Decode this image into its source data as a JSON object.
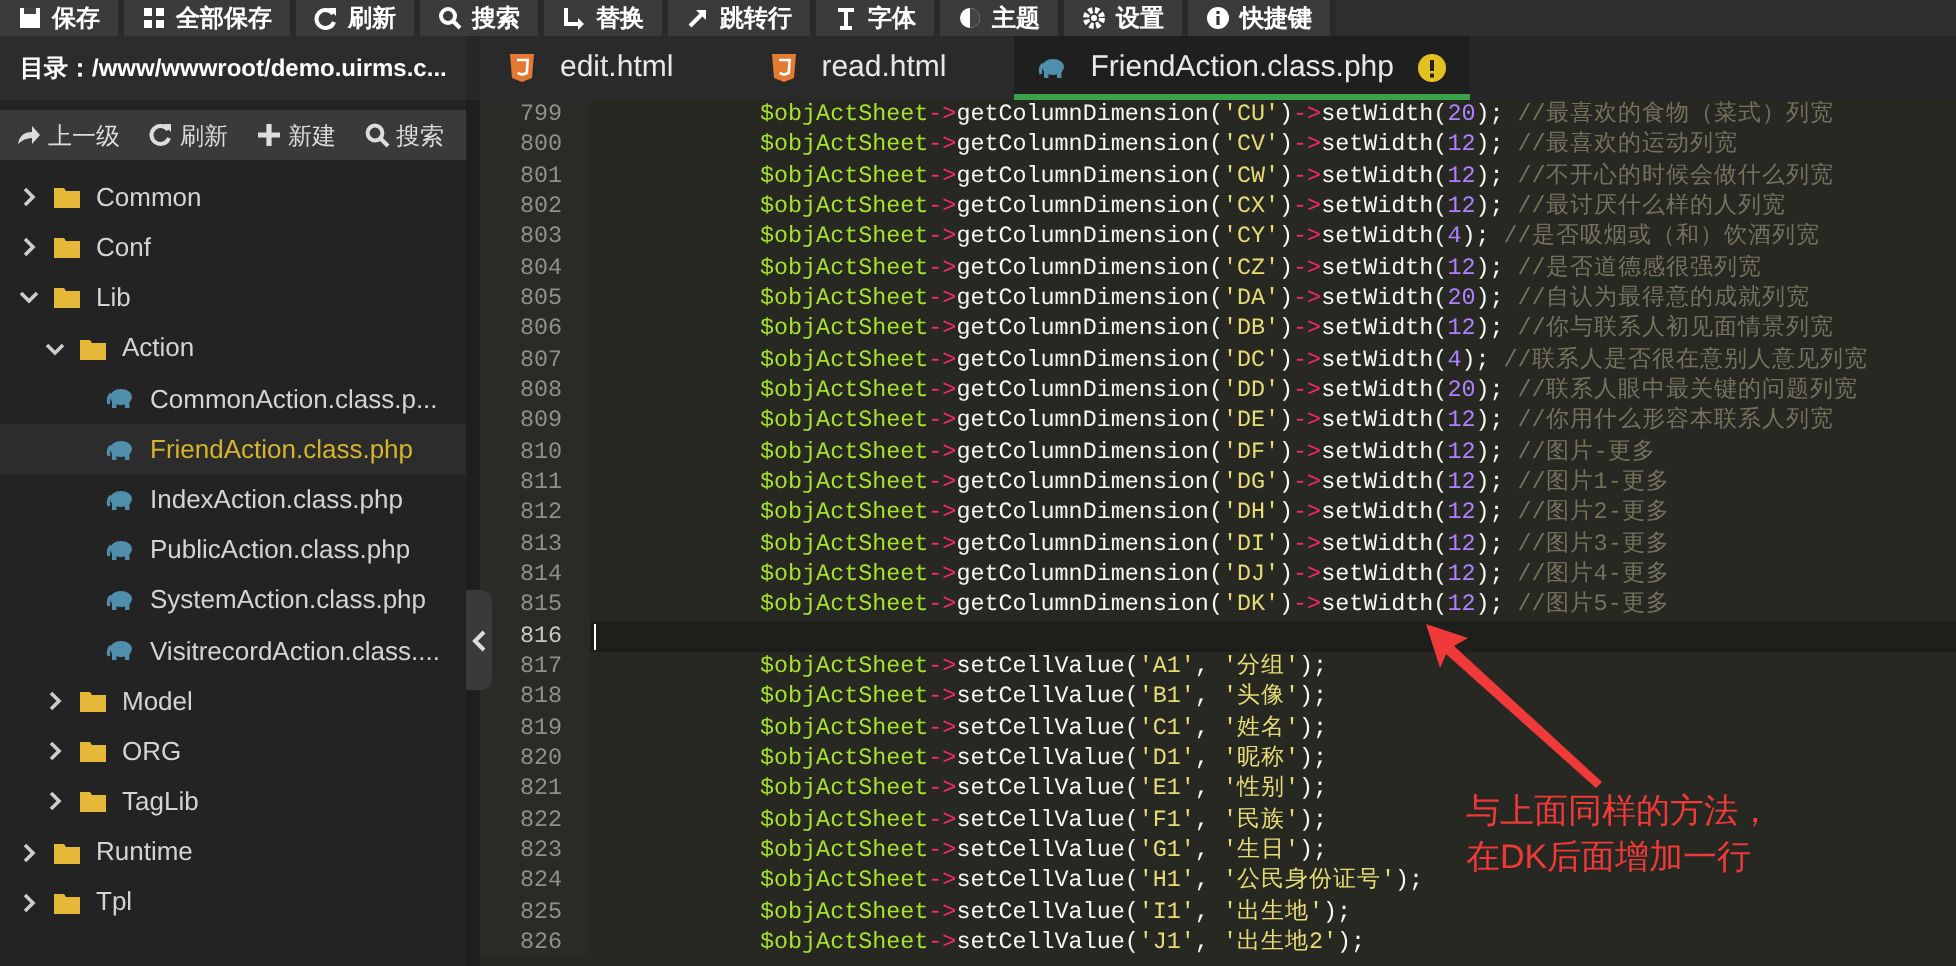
{
  "toolbar": [
    "保存",
    "全部保存",
    "刷新",
    "搜索",
    "替换",
    "跳转行",
    "字体",
    "主题",
    "设置",
    "快捷键"
  ],
  "directory": "目录：/www/wwwroot/demo.uirms.c...",
  "tabs": [
    {
      "label": "edit.html",
      "kind": "html",
      "selected": false,
      "warning": false
    },
    {
      "label": "read.html",
      "kind": "html",
      "selected": false,
      "warning": false
    },
    {
      "label": "FriendAction.class.php",
      "kind": "php",
      "selected": true,
      "warning": true
    }
  ],
  "file_toolbar": [
    "上一级",
    "刷新",
    "新建",
    "搜索"
  ],
  "tree": [
    {
      "label": "Common",
      "kind": "folder",
      "expanded": false,
      "selected": false
    },
    {
      "label": "Conf",
      "kind": "folder",
      "expanded": false,
      "selected": false
    },
    {
      "label": "Lib",
      "kind": "folder",
      "expanded": true,
      "selected": false,
      "children": [
        {
          "label": "Action",
          "kind": "folder",
          "expanded": true,
          "selected": false,
          "children": [
            {
              "label": "CommonAction.class.p...",
              "kind": "php",
              "selected": false
            },
            {
              "label": "FriendAction.class.php",
              "kind": "php",
              "selected": true
            },
            {
              "label": "IndexAction.class.php",
              "kind": "php",
              "selected": false
            },
            {
              "label": "PublicAction.class.php",
              "kind": "php",
              "selected": false
            },
            {
              "label": "SystemAction.class.php",
              "kind": "php",
              "selected": false
            },
            {
              "label": "VisitrecordAction.class....",
              "kind": "php",
              "selected": false
            }
          ]
        },
        {
          "label": "Model",
          "kind": "folder",
          "expanded": false,
          "selected": false
        },
        {
          "label": "ORG",
          "kind": "folder",
          "expanded": false,
          "selected": false
        },
        {
          "label": "TagLib",
          "kind": "folder",
          "expanded": false,
          "selected": false
        }
      ]
    },
    {
      "label": "Runtime",
      "kind": "folder",
      "expanded": false,
      "selected": false
    },
    {
      "label": "Tpl",
      "kind": "folder",
      "expanded": false,
      "selected": false
    }
  ],
  "editor": {
    "lines": [
      {
        "number": "799",
        "code": "$objActSheet->getColumnDimension('CU')->setWidth(20); //最喜欢的食物（菜式）列宽",
        "current": false
      },
      {
        "number": "800",
        "code": "$objActSheet->getColumnDimension('CV')->setWidth(12); //最喜欢的运动列宽",
        "current": false
      },
      {
        "number": "801",
        "code": "$objActSheet->getColumnDimension('CW')->setWidth(12); //不开心的时候会做什么列宽",
        "current": false
      },
      {
        "number": "802",
        "code": "$objActSheet->getColumnDimension('CX')->setWidth(12); //最讨厌什么样的人列宽",
        "current": false
      },
      {
        "number": "803",
        "code": "$objActSheet->getColumnDimension('CY')->setWidth(4); //是否吸烟或（和）饮酒列宽",
        "current": false
      },
      {
        "number": "804",
        "code": "$objActSheet->getColumnDimension('CZ')->setWidth(12); //是否道德感很强列宽",
        "current": false
      },
      {
        "number": "805",
        "code": "$objActSheet->getColumnDimension('DA')->setWidth(20); //自认为最得意的成就列宽",
        "current": false
      },
      {
        "number": "806",
        "code": "$objActSheet->getColumnDimension('DB')->setWidth(12); //你与联系人初见面情景列宽",
        "current": false
      },
      {
        "number": "807",
        "code": "$objActSheet->getColumnDimension('DC')->setWidth(4); //联系人是否很在意别人意见列宽",
        "current": false
      },
      {
        "number": "808",
        "code": "$objActSheet->getColumnDimension('DD')->setWidth(20); //联系人眼中最关键的问题列宽",
        "current": false
      },
      {
        "number": "809",
        "code": "$objActSheet->getColumnDimension('DE')->setWidth(12); //你用什么形容本联系人列宽",
        "current": false
      },
      {
        "number": "810",
        "code": "$objActSheet->getColumnDimension('DF')->setWidth(12); //图片-更多",
        "current": false
      },
      {
        "number": "811",
        "code": "$objActSheet->getColumnDimension('DG')->setWidth(12); //图片1-更多",
        "current": false
      },
      {
        "number": "812",
        "code": "$objActSheet->getColumnDimension('DH')->setWidth(12); //图片2-更多",
        "current": false
      },
      {
        "number": "813",
        "code": "$objActSheet->getColumnDimension('DI')->setWidth(12); //图片3-更多",
        "current": false
      },
      {
        "number": "814",
        "code": "$objActSheet->getColumnDimension('DJ')->setWidth(12); //图片4-更多",
        "current": false
      },
      {
        "number": "815",
        "code": "$objActSheet->getColumnDimension('DK')->setWidth(12); //图片5-更多",
        "current": false
      },
      {
        "number": "816",
        "current": true
      },
      {
        "number": "817",
        "code": "$objActSheet->setCellValue('A1', '分组');",
        "current": false
      },
      {
        "number": "818",
        "code": "$objActSheet->setCellValue('B1', '头像');",
        "current": false
      },
      {
        "number": "819",
        "code": "$objActSheet->setCellValue('C1', '姓名');",
        "current": false
      },
      {
        "number": "820",
        "code": "$objActSheet->setCellValue('D1', '昵称');",
        "current": false
      },
      {
        "number": "821",
        "code": "$objActSheet->setCellValue('E1', '性别');",
        "current": false
      },
      {
        "number": "822",
        "code": "$objActSheet->setCellValue('F1', '民族');",
        "current": false
      },
      {
        "number": "823",
        "code": "$objActSheet->setCellValue('G1', '生日');",
        "current": false
      },
      {
        "number": "824",
        "code": "$objActSheet->setCellValue('H1', '公民身份证号');",
        "current": false
      },
      {
        "number": "825",
        "code": "$objActSheet->setCellValue('I1', '出生地');",
        "current": false
      },
      {
        "number": "826",
        "code": "$objActSheet->setCellValue('J1', '出生地2');",
        "current": false
      }
    ]
  },
  "annotation": [
    "与上面同样的方法，",
    "在DK后面增加一行"
  ]
}
